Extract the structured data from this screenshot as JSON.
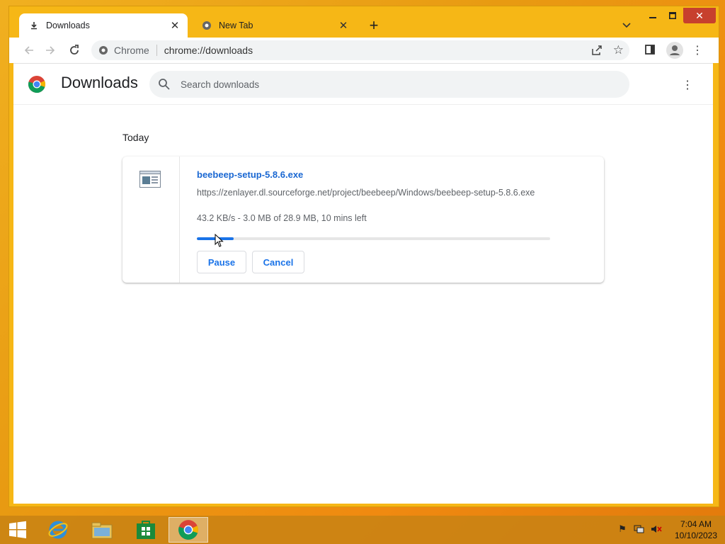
{
  "browser": {
    "tabs": [
      {
        "label": "Downloads",
        "active": true,
        "icon": "download-icon"
      },
      {
        "label": "New Tab",
        "active": false,
        "icon": "chrome-icon"
      }
    ],
    "omnibox": {
      "site_label": "Chrome",
      "url": "chrome://downloads"
    }
  },
  "downloads": {
    "title": "Downloads",
    "search_placeholder": "Search downloads",
    "section": "Today",
    "item": {
      "filename": "beebeep-setup-5.8.6.exe",
      "url": "https://zenlayer.dl.sourceforge.net/project/beebeep/Windows/beebeep-setup-5.8.6.exe",
      "status": "43.2 KB/s - 3.0 MB of 28.9 MB, 10 mins left",
      "progress_fraction": 0.104,
      "pause_label": "Pause",
      "cancel_label": "Cancel"
    }
  },
  "taskbar": {
    "time": "7:04 AM",
    "date": "10/10/2023",
    "apps": [
      "start-button",
      "internet-explorer-icon",
      "file-explorer-icon",
      "store-icon",
      "chrome-icon"
    ]
  },
  "colors": {
    "accent": "#1a73e8",
    "window_frame": "#f6b716",
    "close_button": "#c7402d"
  }
}
